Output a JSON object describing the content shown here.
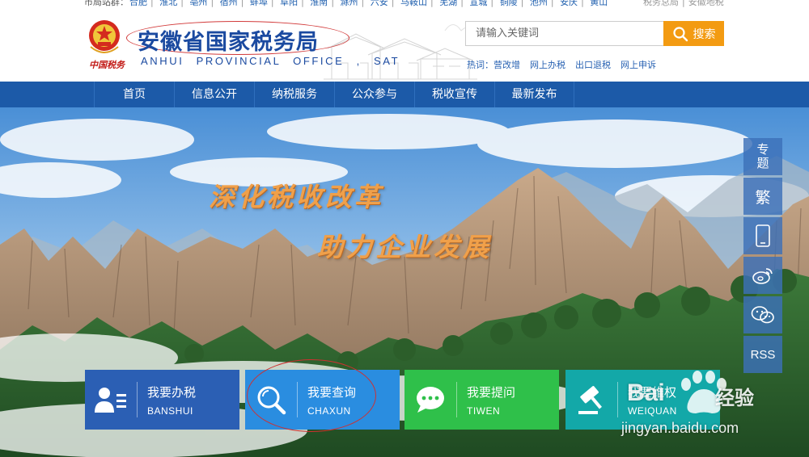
{
  "city_strip": {
    "lead": "市局站群：",
    "cities": [
      "合肥",
      "淮北",
      "亳州",
      "宿州",
      "蚌埠",
      "阜阳",
      "淮南",
      "滁州",
      "六安",
      "马鞍山",
      "芜湖",
      "宣城",
      "铜陵",
      "池州",
      "安庆",
      "黄山"
    ],
    "right_links": [
      "税务总局",
      "安徽地税"
    ]
  },
  "header": {
    "emblem_text": "中国税务",
    "title": "安徽省国家税务局",
    "subtitle": "ANHUI PROVINCIAL OFFICE , SAT",
    "search": {
      "placeholder": "请输入关键词",
      "button_label": "搜索"
    },
    "hot": {
      "label": "热词：",
      "links": [
        "营改增",
        "网上办税",
        "出口退税",
        "网上申诉"
      ]
    }
  },
  "nav": {
    "items": [
      "首页",
      "信息公开",
      "纳税服务",
      "公众参与",
      "税收宣传",
      "最新发布"
    ]
  },
  "banner": {
    "slogan_line1": "深化税收改革",
    "slogan_line2": "助力企业发展"
  },
  "sidebar": {
    "items": [
      {
        "label": "专\n题",
        "icon": "topic"
      },
      {
        "label": "繁",
        "icon": "traditional-chinese"
      },
      {
        "label": "",
        "icon": "mobile-icon"
      },
      {
        "label": "",
        "icon": "weibo-icon"
      },
      {
        "label": "",
        "icon": "wechat-icon"
      },
      {
        "label": "RSS",
        "icon": "rss"
      }
    ]
  },
  "tiles": [
    {
      "name": "我要办税",
      "sub": "BANSHUI",
      "icon": "user-list-icon",
      "color": "#2b5fb4"
    },
    {
      "name": "我要查询",
      "sub": "CHAXUN",
      "icon": "magnifier-icon",
      "color": "#2a8de0"
    },
    {
      "name": "我要提问",
      "sub": "TIWEN",
      "icon": "chat-bubble-icon",
      "color": "#2fc04a"
    },
    {
      "name": "我要维权",
      "sub": "WEIQUAN",
      "icon": "gavel-icon",
      "color": "#13a8a8"
    }
  ],
  "watermark": {
    "brand": "Bai",
    "brand_cn": "经验",
    "url": "jingyan.baidu.com"
  },
  "colors": {
    "nav_blue": "#1c5aa8",
    "title_blue": "#1b4aa0",
    "search_orange": "#f39b12",
    "annotation_red": "#d23a3a"
  }
}
